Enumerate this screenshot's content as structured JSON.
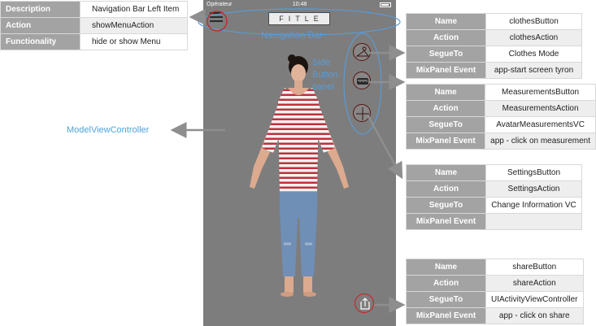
{
  "status_bar": {
    "carrier": "Opérateur",
    "time": "10:48"
  },
  "app": {
    "logo": "FITLE"
  },
  "labels": {
    "nav_bar": "Navigation Bar",
    "side_panel": [
      "Side",
      "Button",
      "panel"
    ],
    "model_view": "ModelViewController"
  },
  "nav_left_item": {
    "rows": [
      {
        "key": "Description",
        "value": "Navigation Bar Left Item"
      },
      {
        "key": "Action",
        "value": "showMenuAction"
      },
      {
        "key": "Functionality",
        "value": "hide or show Menu"
      }
    ]
  },
  "clothes_button": {
    "rows": [
      {
        "key": "Name",
        "value": "clothesButton"
      },
      {
        "key": "Action",
        "value": "clothesAction"
      },
      {
        "key": "SegueTo",
        "value": "Clothes Mode"
      },
      {
        "key": "MixPanel  Event",
        "value": "app-start screen tyron"
      }
    ]
  },
  "measurements_button": {
    "rows": [
      {
        "key": "Name",
        "value": "MeasurementsButton"
      },
      {
        "key": "Action",
        "value": "MeasurementsAction"
      },
      {
        "key": "SegueTo",
        "value": "AvatarMeasurementsVC"
      },
      {
        "key": "MixPanel  Event",
        "value": "app - click on measurement"
      }
    ]
  },
  "settings_button": {
    "rows": [
      {
        "key": "Name",
        "value": "SettingsButton"
      },
      {
        "key": "Action",
        "value": "SettingsAction"
      },
      {
        "key": "SegueTo",
        "value": "Change Information VC"
      },
      {
        "key": "MixPanel  Event",
        "value": ""
      }
    ]
  },
  "share_button": {
    "rows": [
      {
        "key": "Name",
        "value": "shareButton"
      },
      {
        "key": "Action",
        "value": "shareAction"
      },
      {
        "key": "SegueTo",
        "value": "UIActivityViewController"
      },
      {
        "key": "MixPanel  Event",
        "value": "app - click on share"
      }
    ]
  },
  "colors": {
    "annotation_blue": "#5b9bd5",
    "arrow_gray": "#8e8e8e",
    "highlight_red": "#cc1e1e",
    "phone_bg": "#7d7d7d",
    "table_key_bg": "#a3a3a3"
  }
}
